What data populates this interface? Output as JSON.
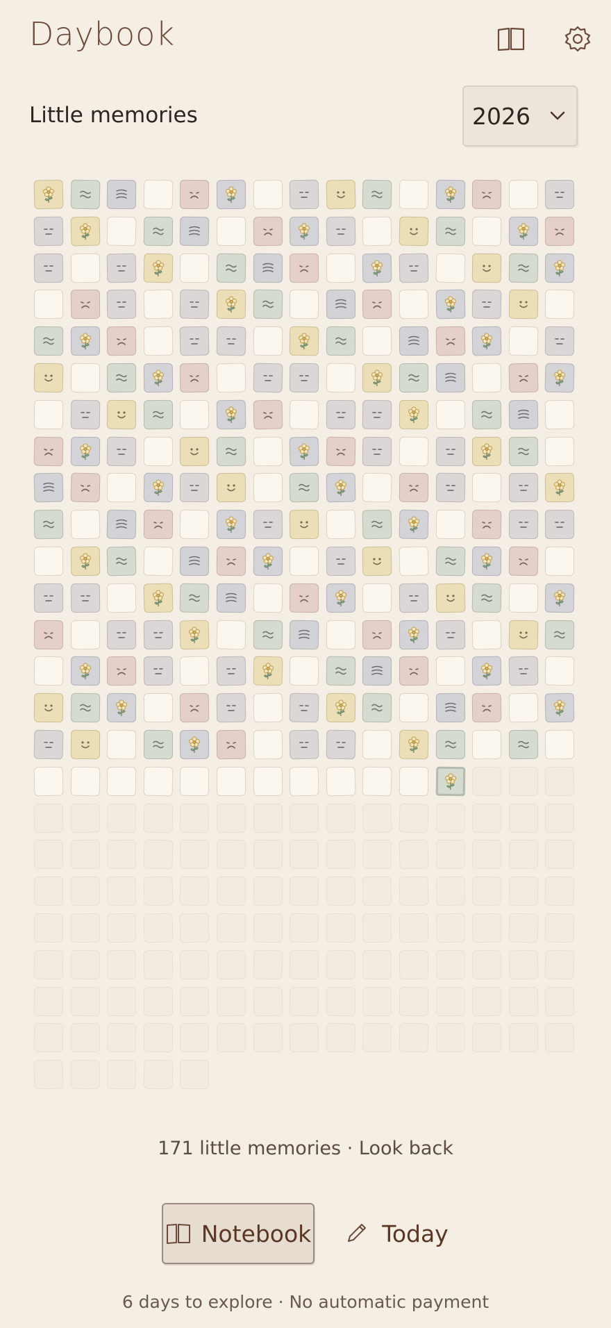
{
  "app": {
    "title": "Daybook"
  },
  "header": {
    "notebook_icon": "book-open-icon",
    "settings_icon": "gear-icon"
  },
  "section": {
    "title": "Little memories"
  },
  "year_select": {
    "value": "2026",
    "icon": "chevron-down-icon"
  },
  "grid": {
    "days_total": 365,
    "today_index": 257,
    "mood_colors": {
      "joy": "#ecdfb8",
      "flower": "#d3d3d8",
      "calm": "#d6dbcf",
      "wind": "#d3d3d7",
      "sad": "#e5cfcb",
      "neutral": "#dcd7d7",
      "blank": "#fbf7ef",
      "future": "#f1ebe1"
    },
    "mood_icons": {
      "joy": "smile-face-icon",
      "flower": "flower-icon",
      "calm": "wave-icon",
      "wind": "wind-lines-icon",
      "sad": "sad-face-icon",
      "neutral": "neutral-face-icon"
    },
    "entries": [
      "joy-f",
      "calm",
      "wind",
      "blank",
      "sad",
      "flower",
      "blank",
      "neutral",
      "joy",
      "calm",
      "blank",
      "flower",
      "sad",
      "blank",
      "neutral",
      "neutral",
      "joy-f",
      "blank",
      "calm",
      "wind",
      "blank",
      "sad",
      "flower",
      "neutral",
      "blank",
      "joy",
      "calm",
      "blank",
      "flower",
      "sad",
      "neutral",
      "blank",
      "neutral",
      "joy-f",
      "blank",
      "calm",
      "wind",
      "sad",
      "blank",
      "flower",
      "neutral",
      "blank",
      "joy",
      "calm",
      "flower",
      "blank",
      "sad",
      "neutral",
      "blank",
      "neutral",
      "joy-f",
      "calm",
      "blank",
      "wind",
      "sad",
      "blank",
      "flower",
      "neutral",
      "joy",
      "blank",
      "calm",
      "flower",
      "sad",
      "blank",
      "neutral",
      "neutral",
      "blank",
      "joy-f",
      "calm",
      "blank",
      "wind",
      "sad",
      "flower",
      "blank",
      "neutral",
      "joy",
      "blank",
      "calm",
      "flower",
      "sad",
      "blank",
      "neutral",
      "neutral",
      "blank",
      "joy-f",
      "calm",
      "wind",
      "blank",
      "sad",
      "flower",
      "blank",
      "neutral",
      "joy",
      "calm",
      "blank",
      "flower",
      "sad",
      "blank",
      "neutral",
      "neutral",
      "joy-f",
      "blank",
      "calm",
      "wind",
      "blank",
      "sad",
      "flower",
      "neutral",
      "blank",
      "joy",
      "calm",
      "blank",
      "flower",
      "sad",
      "neutral",
      "blank",
      "neutral",
      "joy-f",
      "calm",
      "blank",
      "wind",
      "sad",
      "blank",
      "flower",
      "neutral",
      "joy",
      "blank",
      "calm",
      "flower",
      "blank",
      "sad",
      "neutral",
      "blank",
      "neutral",
      "joy-f",
      "calm",
      "blank",
      "wind",
      "sad",
      "blank",
      "flower",
      "neutral",
      "joy",
      "blank",
      "calm",
      "flower",
      "blank",
      "sad",
      "neutral",
      "neutral",
      "blank",
      "joy-f",
      "calm",
      "blank",
      "wind",
      "sad",
      "flower",
      "blank",
      "neutral",
      "joy",
      "blank",
      "calm",
      "flower",
      "sad",
      "blank",
      "neutral",
      "neutral",
      "blank",
      "joy-f",
      "calm",
      "wind",
      "blank",
      "sad",
      "flower",
      "blank",
      "neutral",
      "joy",
      "calm",
      "blank",
      "flower",
      "sad",
      "blank",
      "neutral",
      "neutral",
      "joy-f",
      "blank",
      "calm",
      "wind",
      "blank",
      "sad",
      "flower",
      "neutral",
      "blank",
      "joy",
      "calm",
      "blank",
      "flower",
      "sad",
      "neutral",
      "blank",
      "neutral",
      "joy-f",
      "blank",
      "calm",
      "wind",
      "sad",
      "blank",
      "flower",
      "neutral",
      "blank",
      "joy",
      "calm",
      "flower",
      "blank",
      "sad",
      "neutral",
      "blank",
      "neutral",
      "joy-f",
      "calm",
      "blank",
      "wind",
      "sad",
      "blank",
      "flower",
      "neutral",
      "joy",
      "blank",
      "calm",
      "flower",
      "sad",
      "blank",
      "neutral",
      "neutral",
      "blank",
      "joy-f",
      "calm",
      "blank",
      "calm",
      "blank",
      "blank",
      "blank",
      "blank",
      "blank",
      "blank",
      "blank",
      "blank",
      "blank",
      "blank",
      "blank",
      "blank",
      "flower-t"
    ]
  },
  "summary": {
    "count_text": "171 little memories",
    "separator": "·",
    "link_text": "Look back"
  },
  "nav": {
    "notebook_label": "Notebook",
    "notebook_icon": "book-open-icon",
    "today_label": "Today",
    "today_icon": "pencil-icon"
  },
  "trial": {
    "text": "6 days to explore · No automatic payment"
  }
}
